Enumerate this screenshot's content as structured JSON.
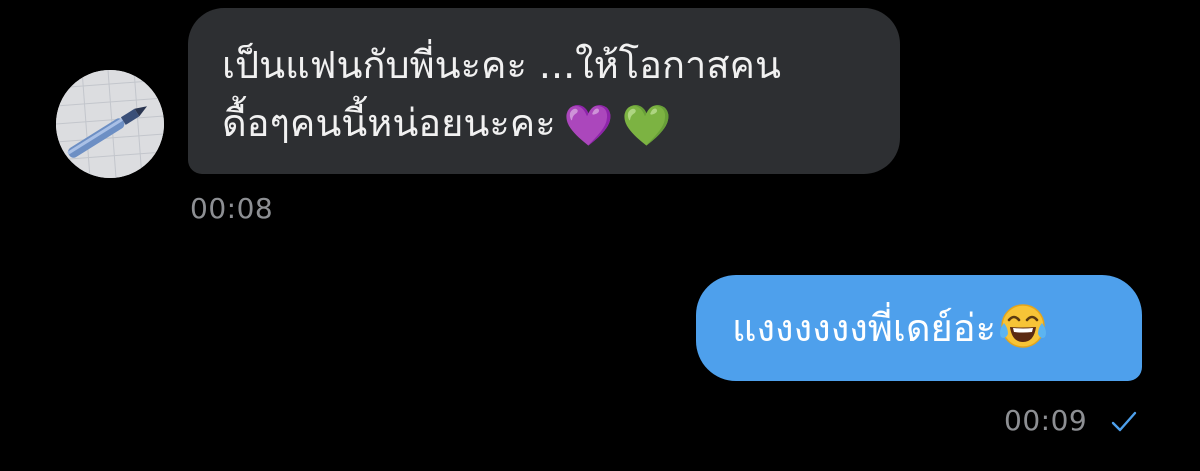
{
  "incoming": {
    "line1": "เป็นแฟนกับพี่นะคะ ...ให้โอกาสคน",
    "line2": "ดื้อๆคนนี้หน่อยนะคะ",
    "heart1": "💜",
    "heart2": "💚",
    "time": "00:08",
    "avatar": "pen-on-notebook-photo"
  },
  "outgoing": {
    "text": "แงงงงงงพี่เดย์อ่ะ",
    "emoji": "face-with-tears-of-joy",
    "time": "00:09",
    "status_icon": "single-check-icon"
  },
  "colors": {
    "background": "#000000",
    "incoming_bubble": "#2d2f32",
    "outgoing_bubble": "#4ea0ec",
    "timestamp": "#8d8f93",
    "check": "#4ea0ec"
  }
}
